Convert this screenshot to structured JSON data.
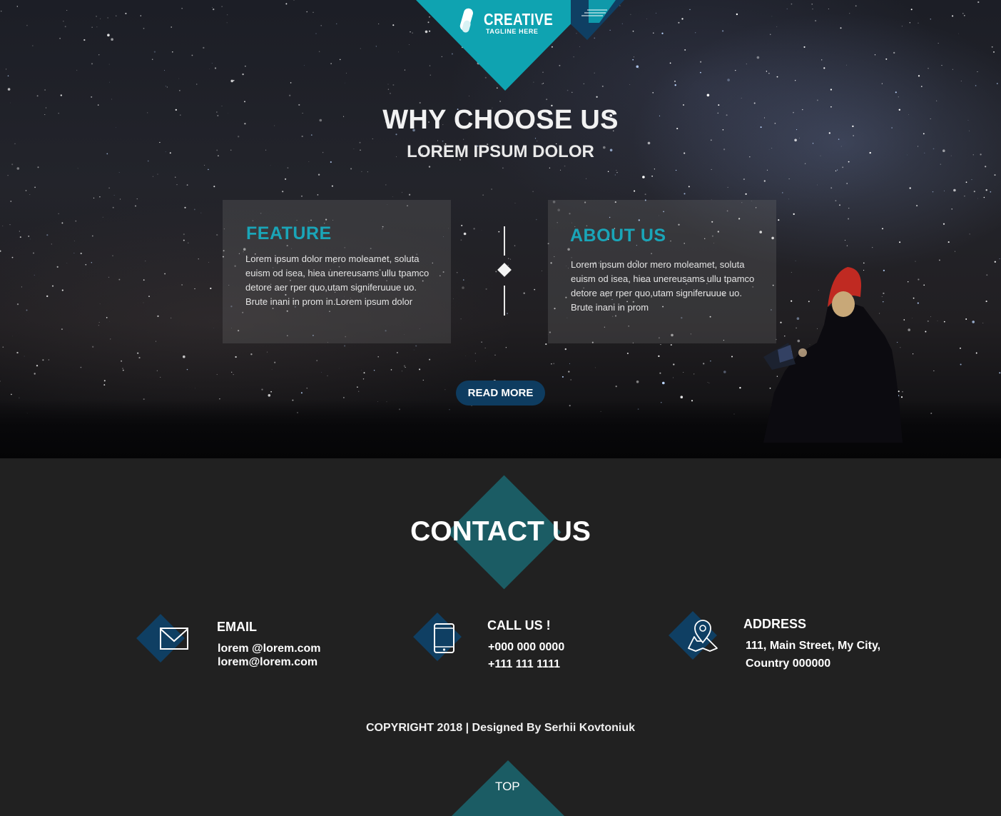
{
  "logo": {
    "title": "CREATIVE",
    "tagline": "TAGLINE HERE",
    "icon": "logo-pill-icon"
  },
  "menu": {
    "icon": "menu-lines-icon"
  },
  "hero": {
    "title": "WHY CHOOSE US",
    "subtitle": "LOREM IPSUM DOLOR",
    "feature": {
      "heading": "FEATURE",
      "text": "Lorem ipsum dolor  mero moleamet, soluta euism od isea, hiea unereusams ullu tpamco detore  aer rper quo,utam signiferuuue uo. Brute inani in prom in.Lorem ipsum dolor"
    },
    "about": {
      "heading": "ABOUT  US",
      "text": "Lorem ipsum dolor  mero moleamet, soluta euism od isea, hiea unereusams ullu tpamco detore  aer rper quo,utam signiferuuue uo. Brute inani in prom"
    },
    "read_more": "READ MORE"
  },
  "contact": {
    "title": "CONTACT US",
    "email": {
      "label": "EMAIL",
      "values": [
        "lorem @lorem.com",
        "lorem@lorem.com"
      ],
      "icon": "envelope-icon"
    },
    "call": {
      "label": "CALL US !",
      "values": [
        "+000 000 0000",
        "+111 111 1111"
      ],
      "icon": "phone-icon"
    },
    "address": {
      "label": "ADDRESS",
      "values": [
        "111, Main Street, My City,",
        "Country 000000"
      ],
      "icon": "map-pin-icon"
    }
  },
  "footer": {
    "copyright": "COPYRIGHT 2018  |  Designed By Serhii Kovtoniuk",
    "top": "TOP"
  },
  "colors": {
    "accent": "#0fa3b1",
    "navy": "#0e3c60",
    "teal_dark": "#1b5c64",
    "footer_bg": "#212121"
  }
}
